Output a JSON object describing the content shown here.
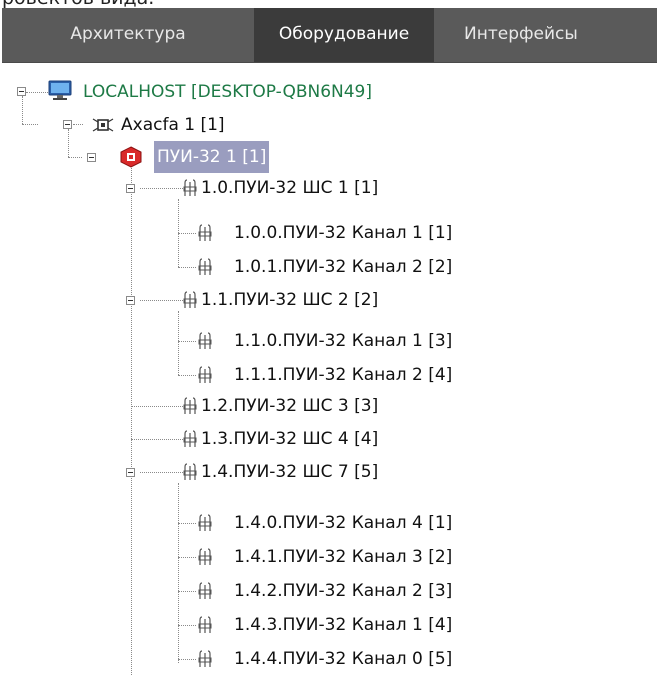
{
  "cut_off_top_text": "ровектов вида.",
  "tabs": [
    {
      "label": "Архитектура",
      "active": false
    },
    {
      "label": "Оборудование",
      "active": true
    },
    {
      "label": "Интерфейсы",
      "active": false
    }
  ],
  "tree": {
    "root": {
      "label": "LOCALHOST [DESKTOP-QBN6N49]",
      "icon": "computer-icon"
    },
    "axxon": {
      "label": "Axacfa 1 [1]",
      "icon": "device-network-icon"
    },
    "pui": {
      "label": "ПУИ-32 1 [1]",
      "icon": "alarm-panel-icon",
      "selected": true
    },
    "items": [
      {
        "label": "1.0.ПУИ-32 ШС 1 [1]"
      },
      {
        "label": "1.0.0.ПУИ-32 Канал 1 [1]"
      },
      {
        "label": "1.0.1.ПУИ-32 Канал 2 [2]"
      },
      {
        "label": "1.1.ПУИ-32 ШС 2 [2]"
      },
      {
        "label": "1.1.0.ПУИ-32 Канал 1 [3]"
      },
      {
        "label": "1.1.1.ПУИ-32 Канал 2 [4]"
      },
      {
        "label": "1.2.ПУИ-32 ШС 3 [3]"
      },
      {
        "label": "1.3.ПУИ-32 ШС 4 [4]"
      },
      {
        "label": "1.4.ПУИ-32 ШС 7 [5]"
      },
      {
        "label": "1.4.0.ПУИ-32 Канал 4 [1]"
      },
      {
        "label": "1.4.1.ПУИ-32 Канал 3 [2]"
      },
      {
        "label": "1.4.2.ПУИ-32 Канал 2 [3]"
      },
      {
        "label": "1.4.3.ПУИ-32 Канал 1 [4]"
      },
      {
        "label": "1.4.4.ПУИ-32 Канал 0 [5]"
      }
    ],
    "item_icon": "sensor-loop-icon"
  },
  "colors": {
    "tab_bar": "#5a5a5a",
    "tab_active": "#3b3b3b",
    "root_text": "#1e7a46",
    "selection": "#9a9dbf"
  }
}
